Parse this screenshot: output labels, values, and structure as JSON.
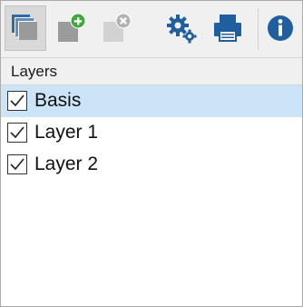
{
  "colors": {
    "toolbar_bg": "#f0f0f0",
    "selected_row": "#cce4f7",
    "icon_blue": "#1f5f9e",
    "icon_green": "#3ea83a",
    "icon_gray": "#b3b3b3"
  },
  "toolbar": {
    "buttons": [
      {
        "name": "layers-view-icon",
        "state": "active"
      },
      {
        "name": "add-layer-icon"
      },
      {
        "name": "remove-layer-icon",
        "state": "disabled"
      },
      {
        "name": "settings-gears-icon"
      },
      {
        "name": "printer-icon"
      },
      {
        "name": "info-icon"
      }
    ]
  },
  "list": {
    "header": "Layers",
    "items": [
      {
        "label": "Basis",
        "checked": true,
        "selected": true
      },
      {
        "label": "Layer 1",
        "checked": true,
        "selected": false
      },
      {
        "label": "Layer 2",
        "checked": true,
        "selected": false
      }
    ]
  }
}
